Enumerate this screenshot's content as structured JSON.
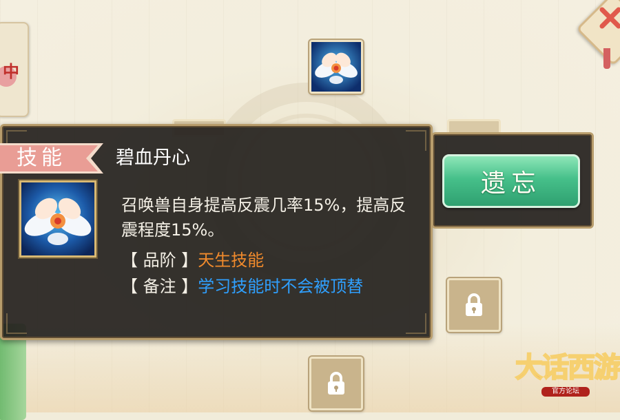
{
  "left_tab": {
    "label": "中"
  },
  "skill_tooltip": {
    "category_label": "技能",
    "skill_name": "碧血丹心",
    "description": "召唤兽自身提高反震几率15%，提高反震程度15%。",
    "grade_label": "【 品阶 】",
    "grade_value": "天生技能",
    "note_label": "【 备注 】",
    "note_value": "学习技能时不会被顶替"
  },
  "actions": {
    "forget_label": "遗忘"
  },
  "logo": {
    "title": "大话西游",
    "subtitle": "官方论坛"
  },
  "icons": {
    "skill": "white-lotus-icon",
    "locked_slot": "lock-icon",
    "close": "close-x-icon"
  },
  "colors": {
    "grade_value": "#f08a2c",
    "note_value": "#2fa0ff",
    "forget_button": "#46c08a",
    "category_ribbon": "#e99d95"
  }
}
